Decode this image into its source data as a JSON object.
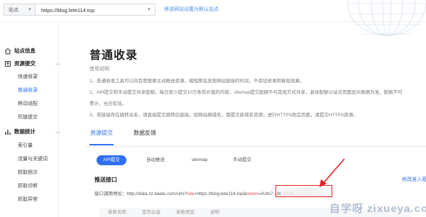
{
  "topbar": {
    "site_label": "站点",
    "site_url": "https://blog.lete114.top",
    "set_default": "将该网站设置为默认站点"
  },
  "sidebar": {
    "groups": [
      {
        "label": "站点信息",
        "icon": "home-icon"
      },
      {
        "label": "资源提交",
        "icon": "upload-icon",
        "items": [
          "快速收录",
          "普通收录",
          "移动适配",
          "死链提交"
        ]
      },
      {
        "label": "数据统计",
        "icon": "bar-chart-icon",
        "items": [
          "索引量",
          "流量与关键词",
          "抓取频次",
          "抓取诊断",
          "抓取异常"
        ]
      }
    ],
    "active_item": "普通收录"
  },
  "main": {
    "title": "普通收录",
    "usage_heading": "使用说明",
    "usage_lines": [
      "1、普通收录工具可以向百度搜索主动推送资源，缩短爬虫发现网站链接的时间，不保证收录和展现效果。",
      "2、API提交和手动提交共享配额，每日至少提交10万条有价值的内容，sitemap提交配额不与其他方式共享，具体配额以站点页面显示数据为准，配额不可",
      "累计，当日有效。",
      "3、若链接存在跳转关系，请直接提交跳转后链接。如网站换域名，需提交新域名资源；进行HTTPS改造页面，请提交HTTPS资源。"
    ],
    "tabs": [
      "资源提交",
      "数据反馈"
    ],
    "sub_tabs": [
      "API提交",
      "自动推送",
      "sitemap",
      "手动提交"
    ],
    "section_title": "推送接口",
    "edit_link": "修改准入密钥",
    "api_prefix": "接口调用地址：http://data.zz.baidu.com/urls?",
    "api_param1": "site",
    "api_mid": "=https://blog.lete114.top&",
    "api_param2": "token",
    "api_token": "=AUto7...8LqBa9",
    "table_headers": [
      "参数名称",
      "是否必选",
      "参数类型",
      "说明"
    ],
    "watermark": "自学呀 zixueya.com"
  }
}
